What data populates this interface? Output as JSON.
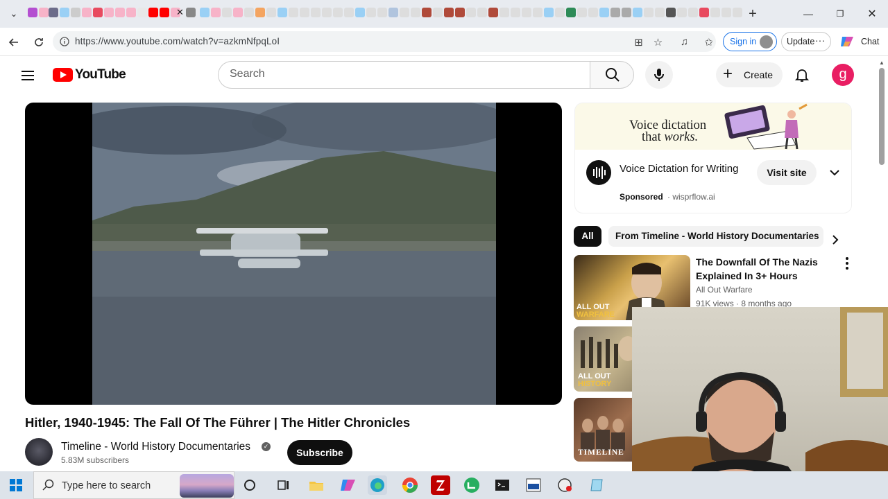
{
  "browser": {
    "url": "https://www.youtube.com/watch?v=azkmNfpqLoI",
    "signin_label": "Sign in",
    "update_label": "Update",
    "chat_label": "Chat"
  },
  "youtube": {
    "search_placeholder": "Search",
    "create_label": "Create",
    "avatar_letter": "g",
    "logo_text": "YouTube"
  },
  "video": {
    "title": "Hitler, 1940-1945: The Fall Of The Führer | The Hitler Chronicles",
    "channel": "Timeline - World History Documentaries",
    "subscribers": "5.83M subscribers",
    "subscribe_label": "Subscribe"
  },
  "ad": {
    "banner_line1": "Voice dictation",
    "banner_line2_prefix": "that ",
    "banner_line2_em": "works.",
    "title": "Voice Dictation for Writing",
    "sponsored": "Sponsored",
    "domain": "· wisprflow.ai",
    "visit_label": "Visit site"
  },
  "chips": {
    "all": "All",
    "from": "From Timeline - World History Documentaries"
  },
  "related": [
    {
      "title": "The Downfall Of The Nazis Explained In 3+ Hours",
      "channel": "All Out Warfare",
      "meta": "91K views · 8 months ago",
      "badge_line1": "ALL OUT",
      "badge_line2": "WARFARE"
    },
    {
      "badge_line1": "ALL OUT",
      "badge_line2": "HISTORY"
    },
    {
      "badge_line1": "TIMELINE"
    }
  ],
  "taskbar": {
    "search_placeholder": "Type here to search"
  }
}
